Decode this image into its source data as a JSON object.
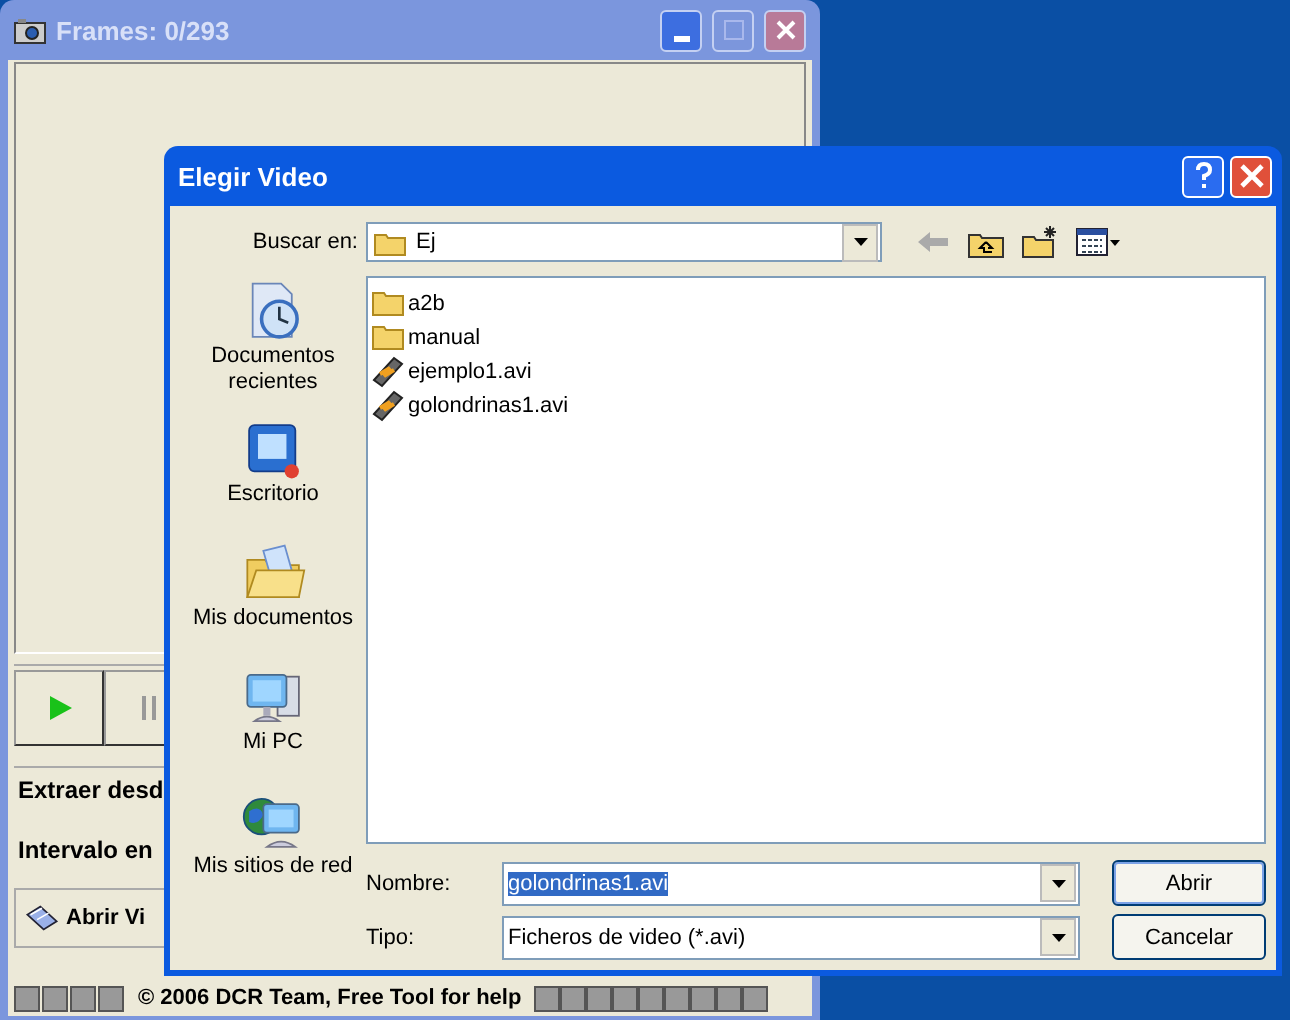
{
  "back_window": {
    "title": "Frames: 0/293",
    "labels": [
      "Extraer desd",
      "Intervalo en"
    ],
    "open_button": "Abrir Vi",
    "status": "© 2006 DCR Team, Free Tool for help"
  },
  "dialog": {
    "title": "Elegir Video",
    "look_in_label": "Buscar en:",
    "look_in_value": "Ej",
    "places": [
      {
        "label": "Documentos recientes",
        "kind": "recent"
      },
      {
        "label": "Escritorio",
        "kind": "desktop"
      },
      {
        "label": "Mis documentos",
        "kind": "documents"
      },
      {
        "label": "Mi PC",
        "kind": "computer"
      },
      {
        "label": "Mis sitios de red",
        "kind": "network"
      }
    ],
    "files": [
      {
        "name": "a2b",
        "kind": "folder"
      },
      {
        "name": "manual",
        "kind": "folder"
      },
      {
        "name": "ejemplo1.avi",
        "kind": "video"
      },
      {
        "name": "golondrinas1.avi",
        "kind": "video"
      }
    ],
    "filename_label": "Nombre:",
    "filename_value": "golondrinas1.avi",
    "filename_text_selected": true,
    "type_label": "Tipo:",
    "type_value": "Ficheros de video (*.avi)",
    "buttons": [
      "Abrir",
      "Cancelar"
    ]
  }
}
